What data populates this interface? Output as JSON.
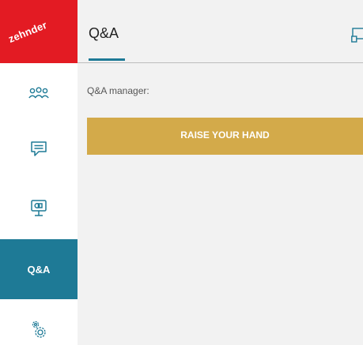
{
  "brand": {
    "logo_text": "zehnder",
    "logo_color": "#e31b23"
  },
  "sidebar": {
    "items": [
      {
        "name": "attendees",
        "icon": "people-icon",
        "active": false
      },
      {
        "name": "chat",
        "icon": "chat-icon",
        "active": false
      },
      {
        "name": "presentation",
        "icon": "presentation-icon",
        "active": false
      },
      {
        "name": "qa",
        "label": "Q&A",
        "active": true
      },
      {
        "name": "settings",
        "icon": "gear-icon",
        "active": false
      }
    ],
    "active_color": "#1e7a96"
  },
  "header": {
    "title": "Q&A",
    "popout_icon": "popout-icon"
  },
  "main": {
    "manager_label": "Q&A manager:",
    "raise_hand_label": "RAISE YOUR HAND",
    "raise_hand_color": "#d3aa4a"
  }
}
